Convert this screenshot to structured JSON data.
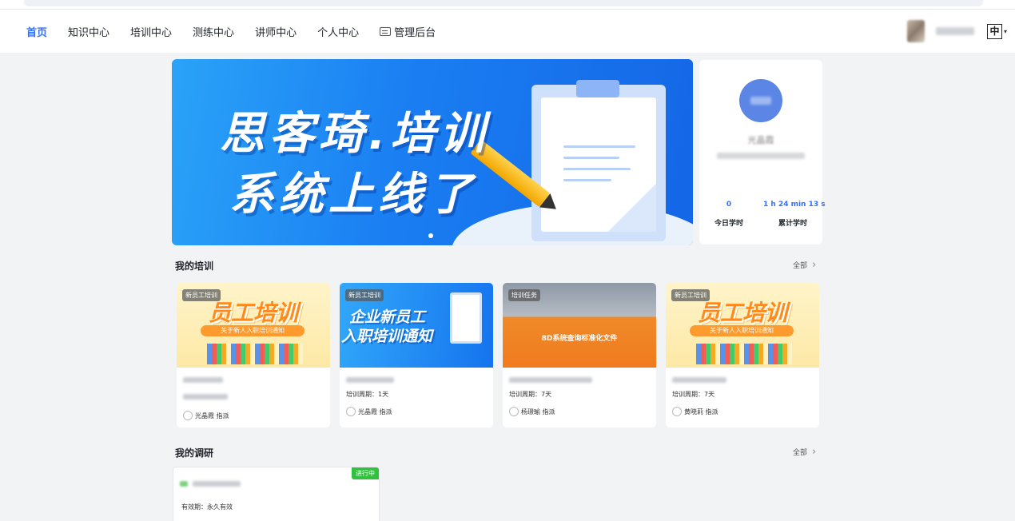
{
  "nav": {
    "items": [
      {
        "label": "首页",
        "active": true
      },
      {
        "label": "知识中心"
      },
      {
        "label": "培训中心"
      },
      {
        "label": "测练中心"
      },
      {
        "label": "讲师中心"
      },
      {
        "label": "个人中心"
      }
    ],
    "admin_label": "管理后台",
    "lang_label": "中",
    "admin_icon": "admin-console-icon"
  },
  "banner": {
    "title_line1": "思客琦.培训",
    "title_line2": "系统上线了"
  },
  "user_card": {
    "name": "光晶霞",
    "today_value": "0",
    "today_label": "今日学时",
    "total_value": "1 h 24 min 13 s",
    "total_label": "累计学时"
  },
  "my_training": {
    "title": "我的培训",
    "more_label": "全部",
    "cards": [
      {
        "tag": "新员工培训",
        "cover_title": "员工培训",
        "cover_sub": "关于新人入职培训通知",
        "period": "",
        "assigner": "光晶霞 指派"
      },
      {
        "tag": "新员工培训",
        "cover_title_1": "企业新员工",
        "cover_title_2": "入职培训通知",
        "period": "培训周期：1天",
        "assigner": "光晶霞 指派"
      },
      {
        "tag": "培训任务",
        "cover_title": "8D系统查询标准化文件",
        "period": "培训周期：7天",
        "assigner": "杨璟瑜 指派"
      },
      {
        "tag": "新员工培训",
        "cover_title": "员工培训",
        "cover_sub": "关于新人入职培训通知",
        "period": "培训周期：7天",
        "assigner": "黄晓莉 指派"
      }
    ]
  },
  "my_survey": {
    "title": "我的调研",
    "more_label": "全部",
    "badge": "进行中",
    "validity": "有效期：永久有效"
  }
}
